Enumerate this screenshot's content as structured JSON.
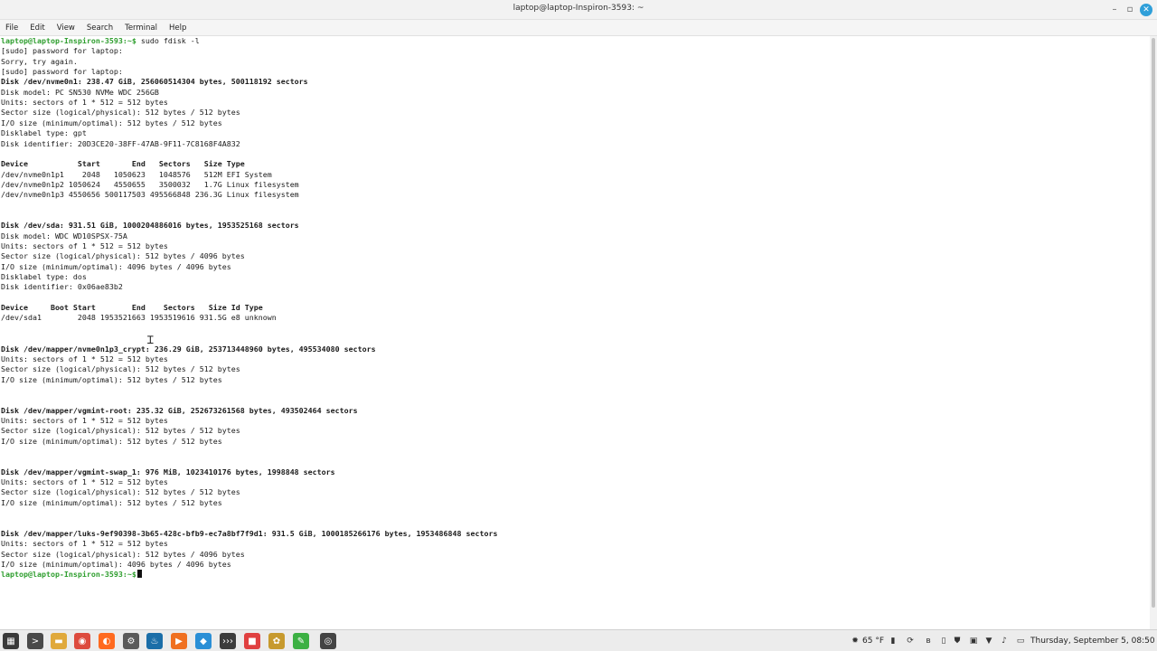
{
  "window": {
    "title": "laptop@laptop-Inspiron-3593: ~",
    "min_glyph": "–",
    "max_glyph": "▫",
    "close_glyph": "✕"
  },
  "menubar": {
    "file": "File",
    "edit": "Edit",
    "view": "View",
    "search": "Search",
    "terminal": "Terminal",
    "help": "Help"
  },
  "terminal": {
    "prompt": "laptop@laptop-Inspiron-3593:~$",
    "command": " sudo fdisk -l",
    "lines": [
      "[sudo] password for laptop:",
      "Sorry, try again.",
      "[sudo] password for laptop:",
      "Disk /dev/nvme0n1: 238.47 GiB, 256060514304 bytes, 500118192 sectors",
      "Disk model: PC SN530 NVMe WDC 256GB",
      "Units: sectors of 1 * 512 = 512 bytes",
      "Sector size (logical/physical): 512 bytes / 512 bytes",
      "I/O size (minimum/optimal): 512 bytes / 512 bytes",
      "Disklabel type: gpt",
      "Disk identifier: 20D3CE20-38FF-47AB-9F11-7C8168F4A832",
      "",
      "Device           Start       End   Sectors   Size Type",
      "/dev/nvme0n1p1    2048   1050623   1048576   512M EFI System",
      "/dev/nvme0n1p2 1050624   4550655   3500032   1.7G Linux filesystem",
      "/dev/nvme0n1p3 4550656 500117503 495566848 236.3G Linux filesystem",
      "",
      "",
      "Disk /dev/sda: 931.51 GiB, 1000204886016 bytes, 1953525168 sectors",
      "Disk model: WDC WD10SPSX-75A",
      "Units: sectors of 1 * 512 = 512 bytes",
      "Sector size (logical/physical): 512 bytes / 4096 bytes",
      "I/O size (minimum/optimal): 4096 bytes / 4096 bytes",
      "Disklabel type: dos",
      "Disk identifier: 0x06ae83b2",
      "",
      "Device     Boot Start        End    Sectors   Size Id Type",
      "/dev/sda1        2048 1953521663 1953519616 931.5G e8 unknown",
      "",
      "",
      "Disk /dev/mapper/nvme0n1p3_crypt: 236.29 GiB, 253713448960 bytes, 495534080 sectors",
      "Units: sectors of 1 * 512 = 512 bytes",
      "Sector size (logical/physical): 512 bytes / 512 bytes",
      "I/O size (minimum/optimal): 512 bytes / 512 bytes",
      "",
      "",
      "Disk /dev/mapper/vgmint-root: 235.32 GiB, 252673261568 bytes, 493502464 sectors",
      "Units: sectors of 1 * 512 = 512 bytes",
      "Sector size (logical/physical): 512 bytes / 512 bytes",
      "I/O size (minimum/optimal): 512 bytes / 512 bytes",
      "",
      "",
      "Disk /dev/mapper/vgmint-swap_1: 976 MiB, 1023410176 bytes, 1998848 sectors",
      "Units: sectors of 1 * 512 = 512 bytes",
      "Sector size (logical/physical): 512 bytes / 512 bytes",
      "I/O size (minimum/optimal): 512 bytes / 512 bytes",
      "",
      "",
      "Disk /dev/mapper/luks-9ef90398-3b65-428c-bfb9-ec7a8bf7f9d1: 931.5 GiB, 1000185266176 bytes, 1953486848 sectors",
      "Units: sectors of 1 * 512 = 512 bytes",
      "Sector size (logical/physical): 512 bytes / 4096 bytes",
      "I/O size (minimum/optimal): 4096 bytes / 4096 bytes"
    ],
    "bold_line_indices": [
      3,
      11,
      17,
      25,
      29,
      35,
      41,
      47
    ],
    "final_prompt": "laptop@laptop-Inspiron-3593:~$"
  },
  "taskbar": {
    "apps": [
      {
        "name": "menu",
        "glyph": "▦",
        "color": "#3a3a3a"
      },
      {
        "name": "terminal",
        "glyph": ">",
        "color": "#4a4a4a"
      },
      {
        "name": "files",
        "glyph": "▬",
        "color": "#e0a93b"
      },
      {
        "name": "chrome",
        "glyph": "◉",
        "color": "#dd4b3e"
      },
      {
        "name": "firefox",
        "glyph": "◐",
        "color": "#ff6a1f"
      },
      {
        "name": "settings",
        "glyph": "⚙",
        "color": "#5a5a5a"
      },
      {
        "name": "steam",
        "glyph": "♨",
        "color": "#1b6ea8"
      },
      {
        "name": "media",
        "glyph": "▶",
        "color": "#f07020"
      },
      {
        "name": "vscode",
        "glyph": "◆",
        "color": "#2a8fd6"
      },
      {
        "name": "code",
        "glyph": "›››",
        "color": "#3c3c3c"
      },
      {
        "name": "app-red",
        "glyph": "■",
        "color": "#e04040"
      },
      {
        "name": "app-gear",
        "glyph": "✿",
        "color": "#c79a2e"
      },
      {
        "name": "app-green",
        "glyph": "✎",
        "color": "#3cb043"
      },
      {
        "name": "app-circle",
        "glyph": "◎",
        "color": "#444444"
      }
    ],
    "weather": "65 °F",
    "datetime": "Thursday, September 5, 08:50"
  },
  "colors": {
    "prompt": "#2e9e2e",
    "close_button": "#2f9fd9"
  }
}
